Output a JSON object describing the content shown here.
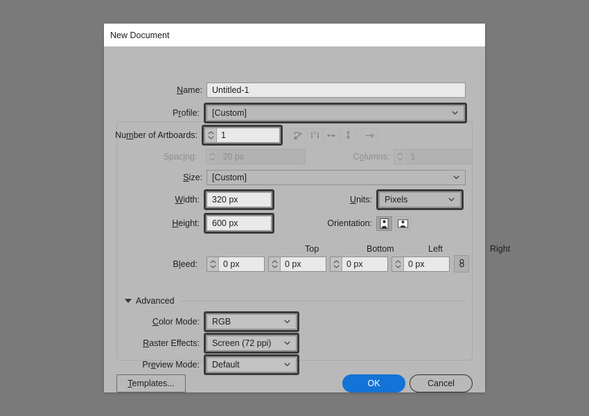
{
  "dialog": {
    "title": "New Document"
  },
  "fields": {
    "name": {
      "label": "Name:",
      "value": "Untitled-1"
    },
    "profile": {
      "label": "Profile:",
      "value": "[Custom]"
    },
    "artboards": {
      "label": "Number of Artboards:",
      "value": "1"
    },
    "spacing": {
      "label": "Spacing:",
      "value": "20 px"
    },
    "columns": {
      "label": "Columns:",
      "value": "1"
    },
    "size": {
      "label": "Size:",
      "value": "[Custom]"
    },
    "width": {
      "label": "Width:",
      "value": "320 px"
    },
    "height": {
      "label": "Height:",
      "value": "600 px"
    },
    "units": {
      "label": "Units:",
      "value": "Pixels"
    },
    "orientation": {
      "label": "Orientation:"
    },
    "bleed": {
      "label": "Bleed:",
      "headers": [
        "Top",
        "Bottom",
        "Left",
        "Right"
      ],
      "values": [
        "0 px",
        "0 px",
        "0 px",
        "0 px"
      ]
    }
  },
  "advanced": {
    "label": "Advanced",
    "color_mode": {
      "label": "Color Mode:",
      "value": "RGB"
    },
    "raster_effects": {
      "label": "Raster Effects:",
      "value": "Screen (72 ppi)"
    },
    "preview_mode": {
      "label": "Preview Mode:",
      "value": "Default"
    }
  },
  "buttons": {
    "templates": "Templates...",
    "ok": "OK",
    "cancel": "Cancel"
  },
  "icons": {
    "arrange_grid_row": "grid-by-row-icon",
    "arrange_grid_column": "grid-by-column-icon",
    "arrange_row": "arrange-by-row-icon",
    "arrange_column": "arrange-by-column-icon",
    "rtl": "right-to-left-layout-icon",
    "portrait": "portrait-orientation-icon",
    "landscape": "landscape-orientation-icon",
    "bleed_link": "link-bleeds-icon"
  },
  "colors": {
    "desktop": "#7a7a7a",
    "dialog": "#b9b9b9",
    "titlebar": "#ffffff",
    "accent": "#1473d6",
    "input": "#e9e9e9",
    "focus_ring": "#3a3a3a"
  }
}
